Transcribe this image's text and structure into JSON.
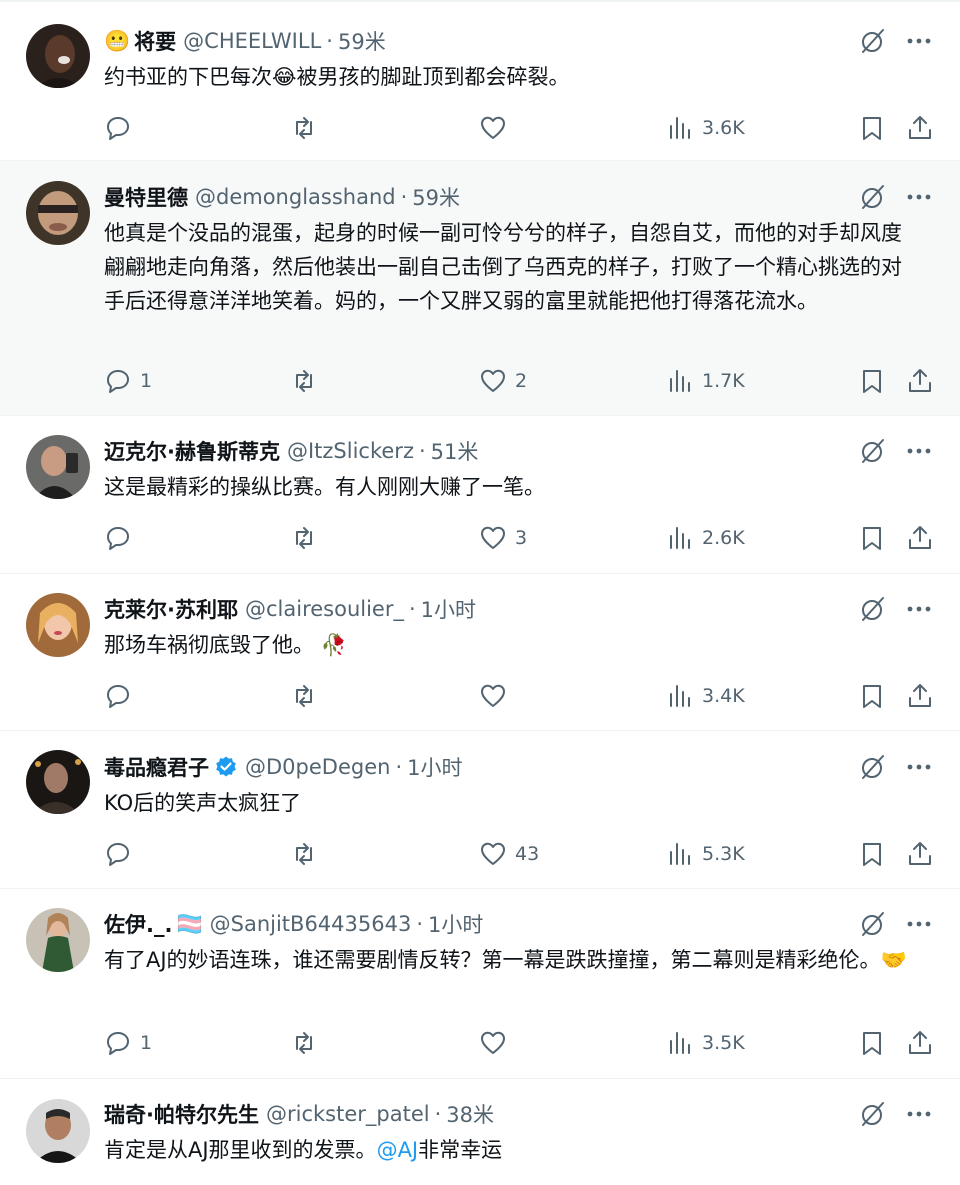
{
  "tweets": [
    {
      "name": "将要",
      "name_emoji": "😬",
      "name_after": "",
      "verified": false,
      "handle": "@CHEELWILL",
      "sep": "·",
      "time": "59米",
      "text": "约书亚的下巴每次😂被男孩的脚趾顶到都会碎裂。",
      "mention": "",
      "text_after": "",
      "replies": "",
      "likes": "",
      "views": "3.6K",
      "highlighted": false,
      "avatar_color": "#3a2a22"
    },
    {
      "name": "曼特里德",
      "name_emoji": "",
      "name_after": "",
      "verified": false,
      "handle": "@demonglasshand",
      "sep": "·",
      "time": "59米",
      "text": "他真是个没品的混蛋，起身的时候一副可怜兮兮的样子，自怨自艾，而他的对手却风度翩翩地走向角落，然后他装出一副自己击倒了乌西克的样子，打败了一个精心挑选的对手后还得意洋洋地笑着。妈的，一个又胖又弱的富里就能把他打得落花流水。",
      "mention": "",
      "text_after": "",
      "replies": "1",
      "likes": "2",
      "views": "1.7K",
      "highlighted": true,
      "avatar_color": "#5b4a3a"
    },
    {
      "name": "迈克尔·赫鲁斯蒂克",
      "name_emoji": "",
      "name_after": "",
      "verified": false,
      "handle": "@ItzSlickerz",
      "sep": "·",
      "time": "51米",
      "text": "这是最精彩的操纵比赛。有人刚刚大赚了一笔。",
      "mention": "",
      "text_after": "",
      "replies": "",
      "likes": "3",
      "views": "2.6K",
      "highlighted": false,
      "avatar_color": "#4a4a4a"
    },
    {
      "name": "克莱尔·苏利耶",
      "name_emoji": "",
      "name_after": "",
      "verified": false,
      "handle": "@clairesoulier_",
      "sep": "·",
      "time": "1小时",
      "text": "那场车祸彻底毁了他。",
      "text_emoji": "🥀",
      "mention": "",
      "text_after": "",
      "replies": "",
      "likes": "",
      "views": "3.4K",
      "highlighted": false,
      "avatar_color": "#d9a26a"
    },
    {
      "name": "毒品瘾君子",
      "name_emoji": "",
      "name_after": "",
      "verified": true,
      "handle": "@D0peDegen",
      "sep": "·",
      "time": "1小时",
      "text": "KO后的笑声太疯狂了",
      "mention": "",
      "text_after": "",
      "replies": "",
      "likes": "43",
      "views": "5.3K",
      "highlighted": false,
      "avatar_color": "#2b2522"
    },
    {
      "name": "佐伊._.",
      "name_emoji": "",
      "name_after": "🏳️‍⚧️",
      "verified": false,
      "handle": "@SanjitB64435643",
      "sep": "·",
      "time": "1小时",
      "text": "有了AJ的妙语连珠，谁还需要剧情反转？第一幕是跌跌撞撞，第二幕则是精彩绝伦。🤝",
      "mention": "",
      "text_after": "",
      "replies": "1",
      "likes": "",
      "views": "3.5K",
      "highlighted": false,
      "avatar_color": "#3d5a3a"
    },
    {
      "name": "瑞奇·帕特尔先生",
      "name_emoji": "",
      "name_after": "",
      "verified": false,
      "handle": "@rickster_patel",
      "sep": "·",
      "time": "38米",
      "text": "肯定是从AJ那里收到的发票。",
      "mention": "@AJ",
      "text_after": "非常幸运",
      "replies": "",
      "likes": "",
      "views": "",
      "highlighted": false,
      "avatar_color": "#c9c9c9"
    }
  ],
  "icons": {
    "reply": "reply-icon",
    "retweet": "retweet-icon",
    "like": "heart-icon",
    "views": "views-icon",
    "bookmark": "bookmark-icon",
    "share": "share-icon",
    "grok": "grok-icon",
    "more": "more-icon",
    "verified": "verified-badge-icon"
  },
  "colors": {
    "text": "#0f1419",
    "muted": "#536471",
    "link": "#1d9bf0",
    "verified": "#1d9bf0",
    "highlight_bg": "#f7f9f9"
  }
}
